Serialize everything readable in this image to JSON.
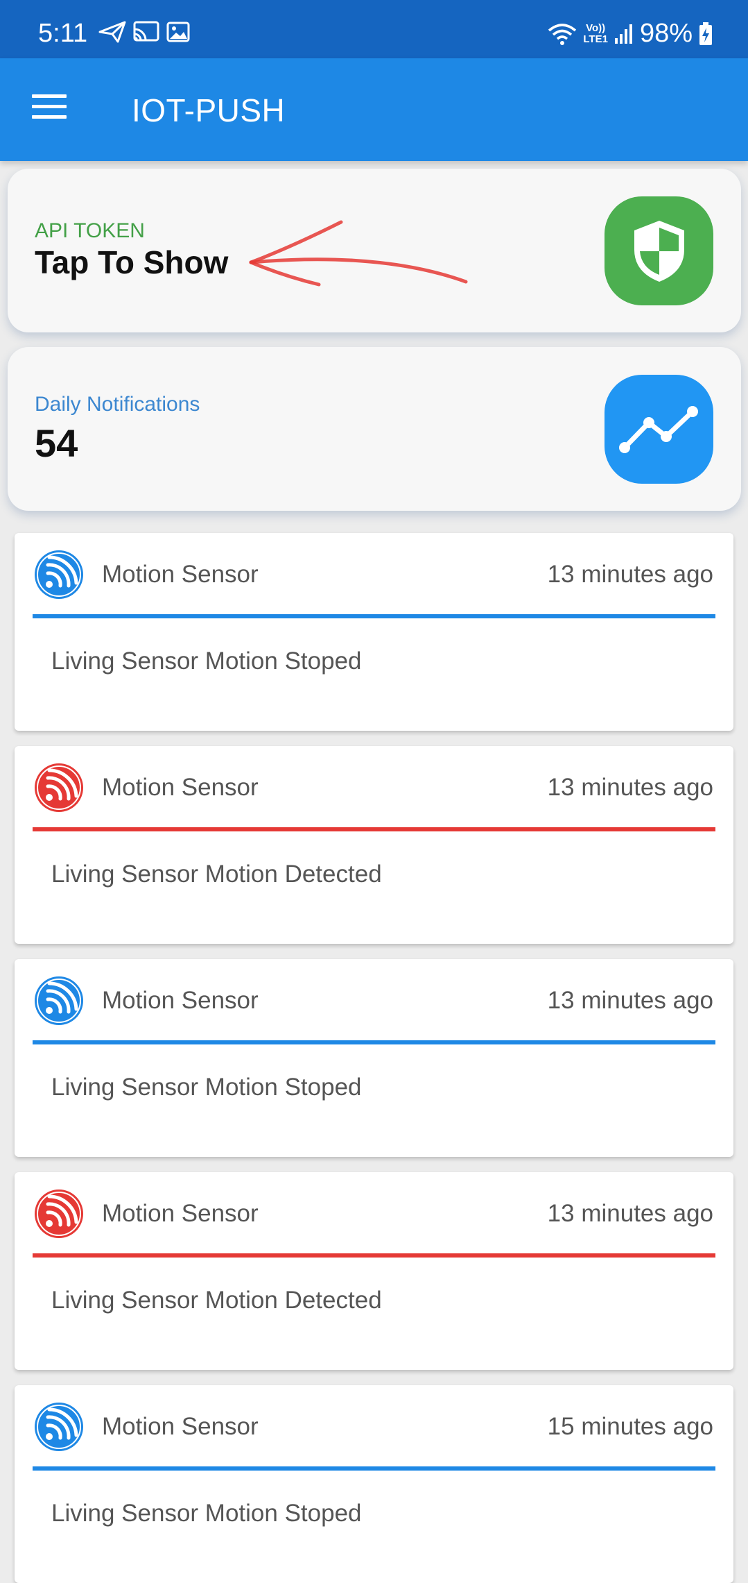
{
  "status_bar": {
    "time": "5:11",
    "battery": "98%",
    "volte_top": "Vo))",
    "volte_bottom": "LTE1",
    "left_icons": [
      "send-icon",
      "cast-icon",
      "image-icon"
    ],
    "right_icons": [
      "wifi-icon",
      "volte-icon",
      "signal-icon",
      "battery-charging-icon"
    ]
  },
  "app_bar": {
    "title": "IOT-PUSH",
    "menu_icon": "menu-icon"
  },
  "token_card": {
    "label": "API TOKEN",
    "value": "Tap To Show",
    "icon": "shield-icon",
    "accent": "#4caf50"
  },
  "daily_card": {
    "label": "Daily Notifications",
    "value": "54",
    "icon": "trending-up-icon",
    "accent": "#2196f3"
  },
  "notifications": [
    {
      "title": "Motion Sensor",
      "time": "13 minutes ago",
      "message": "Living Sensor Motion Stoped",
      "color": "#1e88e5",
      "icon": "esp-wifi-icon"
    },
    {
      "title": "Motion Sensor",
      "time": "13 minutes ago",
      "message": "Living Sensor Motion Detected",
      "color": "#e53935",
      "icon": "esp-wifi-icon"
    },
    {
      "title": "Motion Sensor",
      "time": "13 minutes ago",
      "message": "Living Sensor Motion Stoped",
      "color": "#1e88e5",
      "icon": "esp-wifi-icon"
    },
    {
      "title": "Motion Sensor",
      "time": "13 minutes ago",
      "message": "Living Sensor Motion Detected",
      "color": "#e53935",
      "icon": "esp-wifi-icon"
    },
    {
      "title": "Motion Sensor",
      "time": "15 minutes ago",
      "message": "Living Sensor Motion Stoped",
      "color": "#1e88e5",
      "icon": "esp-wifi-icon"
    }
  ]
}
